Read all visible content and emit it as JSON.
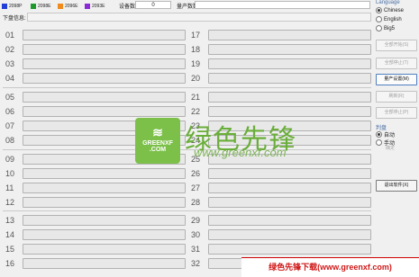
{
  "header": {
    "legend": [
      {
        "label": "2098P",
        "color": "#1f3fd8"
      },
      {
        "label": "2098E",
        "color": "#1e9a2c"
      },
      {
        "label": "2096E",
        "color": "#f08a1c"
      },
      {
        "label": "2093E",
        "color": "#8a2bd8"
      }
    ],
    "device_count_label": "设备数:",
    "device_count_value": "0",
    "production_count_label": "量产数数:",
    "production_count_value": ""
  },
  "download_info_label": "下盘信息:",
  "ports": [
    {
      "left": "01",
      "right": "17"
    },
    {
      "left": "02",
      "right": "18"
    },
    {
      "left": "03",
      "right": "19"
    },
    {
      "left": "04",
      "right": "20"
    },
    {
      "left": "05",
      "right": "21"
    },
    {
      "left": "06",
      "right": "22"
    },
    {
      "left": "07",
      "right": "23"
    },
    {
      "left": "08",
      "right": "24"
    },
    {
      "left": "09",
      "right": "25"
    },
    {
      "left": "10",
      "right": "26"
    },
    {
      "left": "11",
      "right": "27"
    },
    {
      "left": "12",
      "right": "28"
    },
    {
      "left": "13",
      "right": "29"
    },
    {
      "left": "14",
      "right": "30"
    },
    {
      "left": "15",
      "right": "31"
    },
    {
      "left": "16",
      "right": "32"
    }
  ],
  "language": {
    "title": "Language",
    "options": [
      {
        "label": "Chinese",
        "selected": true
      },
      {
        "label": "English",
        "selected": false
      },
      {
        "label": "Big5",
        "selected": false
      }
    ]
  },
  "buttons": {
    "start_all": "全部开始(S)",
    "stop_all": "全部停止(T)",
    "production_settings": "量产设置(M)",
    "refresh": "刷新(R)",
    "stop_all_2": "全部停止(P)",
    "exit": "退出软件(X)"
  },
  "mode": {
    "title": "判盘",
    "auto": "自动",
    "manual": "手动",
    "confirm": "确定"
  },
  "watermark": {
    "logo_text": "GREENXF\n.COM",
    "chinese": "绿色先锋",
    "url": "www.greenxf.com"
  },
  "banner": "绿色先锋下载(www.greenxf.com)"
}
